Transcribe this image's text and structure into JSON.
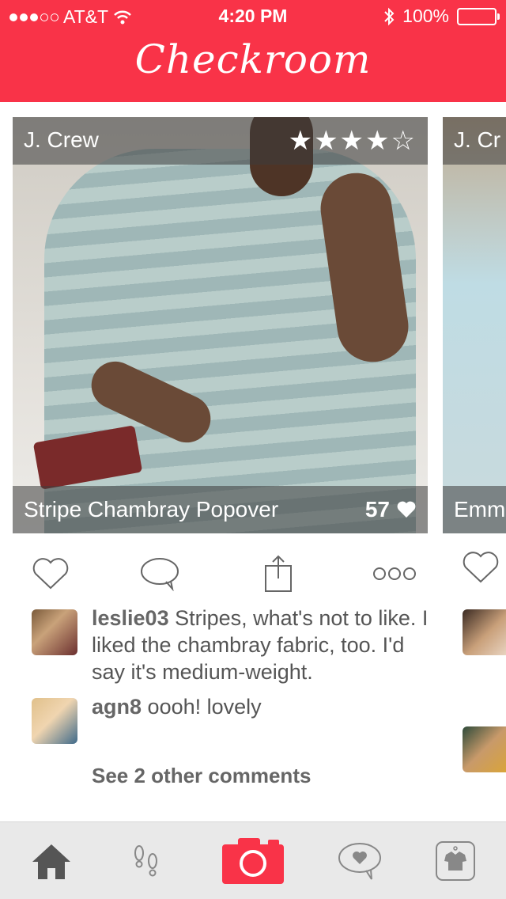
{
  "status_bar": {
    "carrier": "AT&T",
    "time": "4:20 PM",
    "battery": "100%"
  },
  "header": {
    "logo": "Checkroom"
  },
  "colors": {
    "accent": "#f93348",
    "tabbar": "#e9e9e9"
  },
  "post": {
    "brand": "J. Crew",
    "stars": "★★★★☆",
    "rating": 4,
    "title": "Stripe Chambray Popover",
    "likes": "57"
  },
  "next_post": {
    "brand": "J. Cr",
    "title": "Emm"
  },
  "comments": [
    {
      "user": "leslie03",
      "text": "Stripes, what's not to like. I liked the chambray fabric, too. I'd say it's medium-weight."
    },
    {
      "user": "agn8",
      "text": "oooh! lovely"
    }
  ],
  "see_more": "See 2 other comments",
  "tabs": [
    {
      "name": "home-icon"
    },
    {
      "name": "footsteps-icon"
    },
    {
      "name": "camera-icon"
    },
    {
      "name": "chat-heart-icon"
    },
    {
      "name": "closet-icon"
    }
  ]
}
